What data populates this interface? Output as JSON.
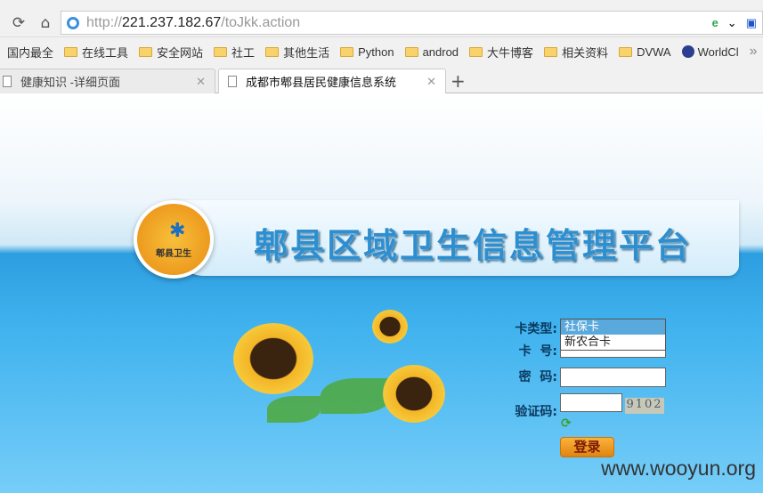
{
  "browser": {
    "url_scheme": "http://",
    "url_host": "221.237.182.67",
    "url_path": "/toJkk.action",
    "bookmarks": [
      "国内最全",
      "在线工具",
      "安全网站",
      "社工",
      "其他生活",
      "Python",
      "androd",
      "大牛博客",
      "相关资料",
      "DVWA",
      "WorldCl"
    ],
    "bookmarks_more": "»",
    "tabs": [
      {
        "label": "健康知识 -详细页面"
      },
      {
        "label": "成都市郫县居民健康信息系统"
      }
    ],
    "new_tab": "+"
  },
  "page": {
    "title": "郫县区域卫生信息管理平台",
    "logo_text": "郫县卫生",
    "form": {
      "card_type_label": "卡类型:",
      "card_type_options": [
        "社保卡",
        "新农合卡"
      ],
      "card_no_label": "卡  号:",
      "password_label": "密  码:",
      "captcha_label": "验证码:",
      "captcha_text": "9102",
      "login_button": "登录"
    },
    "watermark": "www.wooyun.org"
  }
}
